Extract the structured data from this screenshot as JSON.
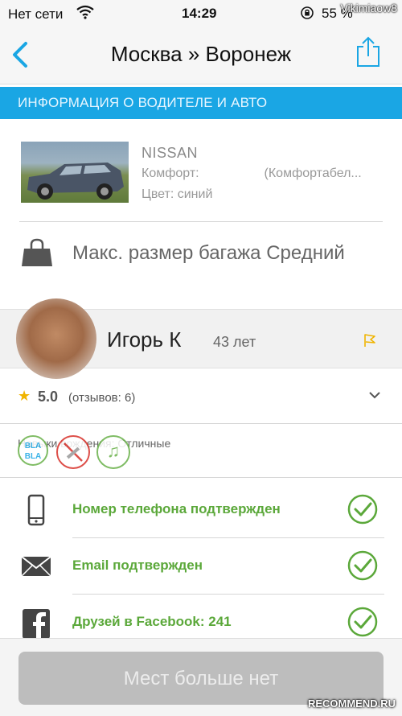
{
  "status_bar": {
    "carrier": "Нет сети",
    "time": "14:29",
    "battery": "55 %",
    "watermark": "Vikimiaow8"
  },
  "nav": {
    "title": "Москва » Воронеж"
  },
  "section": {
    "header": "ИНФОРМАЦИЯ О ВОДИТЕЛЕ И АВТО"
  },
  "car": {
    "model": "NISSAN",
    "comfort": "Комфорт:",
    "comfort_value": "(Комфортабел...",
    "color": "Цвет: синий"
  },
  "luggage": {
    "text": "Макс. размер багажа  Средний"
  },
  "driver": {
    "name": "Игорь К",
    "age": "43 лет"
  },
  "rating": {
    "score": "5.0",
    "reviews": "(отзывов: 6)"
  },
  "preferences": {
    "driving": "Навыки вождения: Отличные",
    "bla": "BLA BLA"
  },
  "verifications": [
    {
      "label": "Номер телефона подтвержден",
      "icon": "phone-icon"
    },
    {
      "label": "Email подтвержден",
      "icon": "envelope-icon"
    },
    {
      "label": "Друзей в Facebook: 241",
      "icon": "facebook-icon"
    }
  ],
  "footer": {
    "button": "Мест больше нет",
    "watermark": "RECOMMEND.RU"
  },
  "colors": {
    "accent_blue": "#1aa6e4",
    "verified_green": "#5ba83a",
    "disabled_button": "#bdbdbd"
  }
}
